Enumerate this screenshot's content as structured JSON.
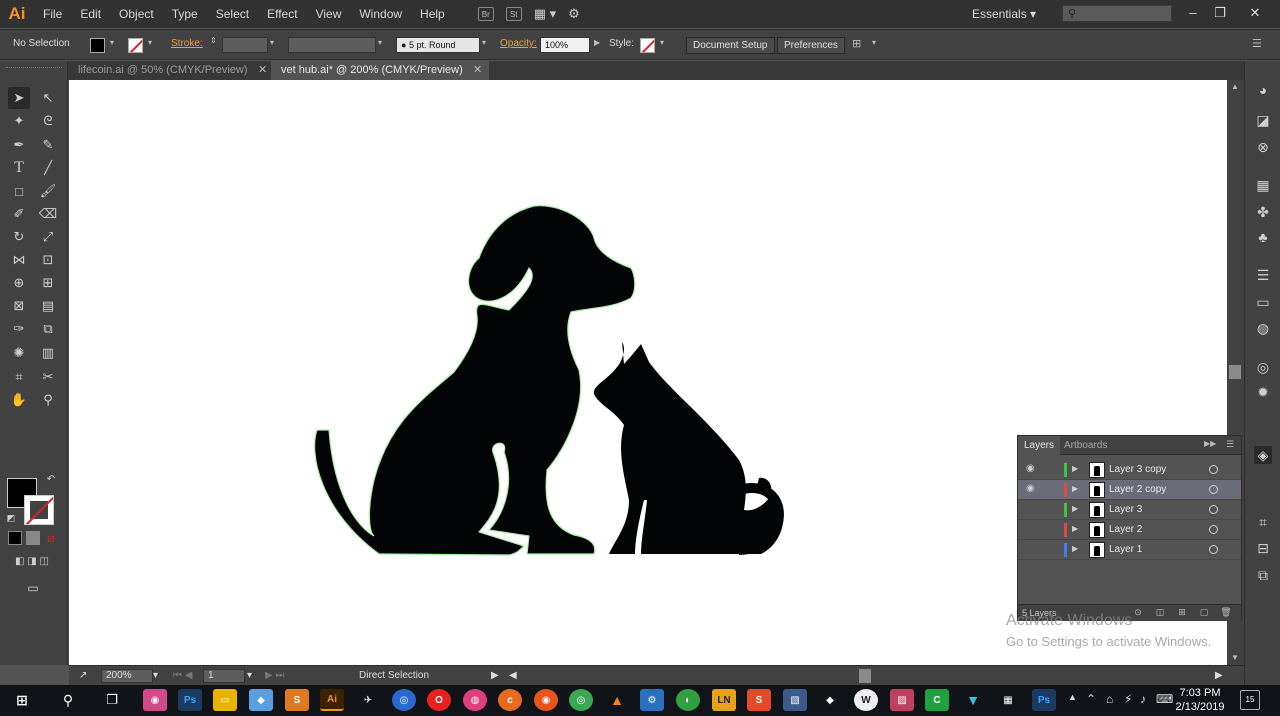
{
  "app": {
    "logo": "Ai",
    "menu": [
      "File",
      "Edit",
      "Object",
      "Type",
      "Select",
      "Effect",
      "View",
      "Window",
      "Help"
    ],
    "menu_icons": [
      "Br",
      "St"
    ],
    "workspace": "Essentials",
    "window_controls": [
      "–",
      "❐",
      "✕"
    ]
  },
  "control_bar": {
    "selection": "No Selection",
    "stroke_label": "Stroke:",
    "brush": "5 pt. Round",
    "brush_dot": "●",
    "opacity_label": "Opacity:",
    "opacity_value": "100%",
    "style_label": "Style:",
    "document_setup": "Document Setup",
    "preferences": "Preferences"
  },
  "tabs": [
    {
      "label": "lifecoin.ai @ 50% (CMYK/Preview)",
      "close": "✕"
    },
    {
      "label": "vet hub.ai* @ 200% (CMYK/Preview)",
      "close": "✕"
    }
  ],
  "status_bar": {
    "zoom": "200%",
    "artboard": "1",
    "tool": "Direct Selection"
  },
  "layers_panel": {
    "tabs": [
      "Layers",
      "Artboards"
    ],
    "layers": [
      {
        "name": "Layer 3 copy",
        "color": "#3ec43e",
        "visible": true,
        "selected": false
      },
      {
        "name": "Layer 2 copy",
        "color": "#e04848",
        "visible": true,
        "selected": true
      },
      {
        "name": "Layer 3",
        "color": "#3ec43e",
        "visible": false,
        "selected": false
      },
      {
        "name": "Layer 2",
        "color": "#e04848",
        "visible": false,
        "selected": false
      },
      {
        "name": "Layer 1",
        "color": "#4a78ff",
        "visible": false,
        "selected": false
      }
    ],
    "count": "5 Layers"
  },
  "watermark": {
    "title": "Activate Windows",
    "subtitle": "Go to Settings to activate Windows."
  },
  "taskbar": {
    "time": "7:03 PM",
    "date": "2/13/2019",
    "notifications": "15",
    "apps": [
      {
        "name": "Ps",
        "color": "#1c3b63"
      },
      {
        "name": "Ai",
        "color": "#3a2200"
      },
      {
        "name": "LN",
        "color": "#e8a21a"
      },
      {
        "name": "S",
        "color": "#e24a2a"
      },
      {
        "name": "Ps",
        "color": "#1c3b63"
      }
    ]
  },
  "colors": {
    "accent_orange": "#f7941d",
    "layer_selected": "#6a6d78",
    "panel_bg": "#535353"
  }
}
